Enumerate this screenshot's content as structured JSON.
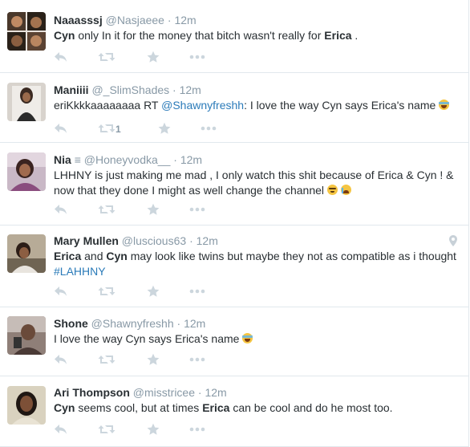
{
  "tweets": [
    {
      "name": "Naaasssj",
      "handle": "@Nasjaeee",
      "sep": "·",
      "time": "12m",
      "text": [
        {
          "b": "Cyn"
        },
        {
          "t": " only In it for the money that bitch wasn't really for "
        },
        {
          "b": "Erica"
        },
        {
          "t": " ."
        }
      ],
      "retweet_count": ""
    },
    {
      "name": "Maniiii",
      "handle": "@_SlimShades",
      "sep": "·",
      "time": "12m",
      "text": [
        {
          "t": "eriKkkkaaaaaaaa RT "
        },
        {
          "l": "@Shawnyfreshh"
        },
        {
          "t": ": I love the way Cyn says Erica's name "
        },
        {
          "e": "joy"
        }
      ],
      "retweet_count": "1"
    },
    {
      "name": "Nia",
      "name_symbol": "≡",
      "handle": "@Honeyvodka__",
      "sep": "·",
      "time": "12m",
      "text": [
        {
          "t": "LHHNY is just making me mad , I only watch this shit because of Erica & Cyn ! & now that they done I might as well change the channel "
        },
        {
          "e": "sweat"
        },
        {
          "e": "cry"
        }
      ],
      "retweet_count": ""
    },
    {
      "name": "Mary Mullen",
      "handle": "@luscious63",
      "sep": "·",
      "time": "12m",
      "text": [
        {
          "b": "Erica"
        },
        {
          "t": " and "
        },
        {
          "b": "Cyn"
        },
        {
          "t": " may look like twins but maybe they not as compatible as i thought "
        },
        {
          "l": "#LAHHNY"
        }
      ],
      "retweet_count": "",
      "has_location": true
    },
    {
      "name": "Shone",
      "handle": "@Shawnyfreshh",
      "sep": "·",
      "time": "12m",
      "text": [
        {
          "t": "I love the way Cyn says Erica's name "
        },
        {
          "e": "joy"
        }
      ],
      "retweet_count": ""
    },
    {
      "name": "Ari Thompson",
      "handle": "@misstricee",
      "sep": "·",
      "time": "12m",
      "text": [
        {
          "b": "Cyn"
        },
        {
          "t": " seems cool, but at times "
        },
        {
          "b": "Erica"
        },
        {
          "t": " can be cool and do he most too."
        }
      ],
      "retweet_count": ""
    }
  ],
  "icons": {
    "reply": "reply-icon",
    "retweet": "retweet-icon",
    "favorite": "star-icon",
    "more": "more-icon",
    "location": "location-pin-icon"
  },
  "colors": {
    "link": "#2b7bb9",
    "action_icon": "#aab8c2",
    "meta": "#8899a6",
    "divider": "#e1e8ed"
  }
}
